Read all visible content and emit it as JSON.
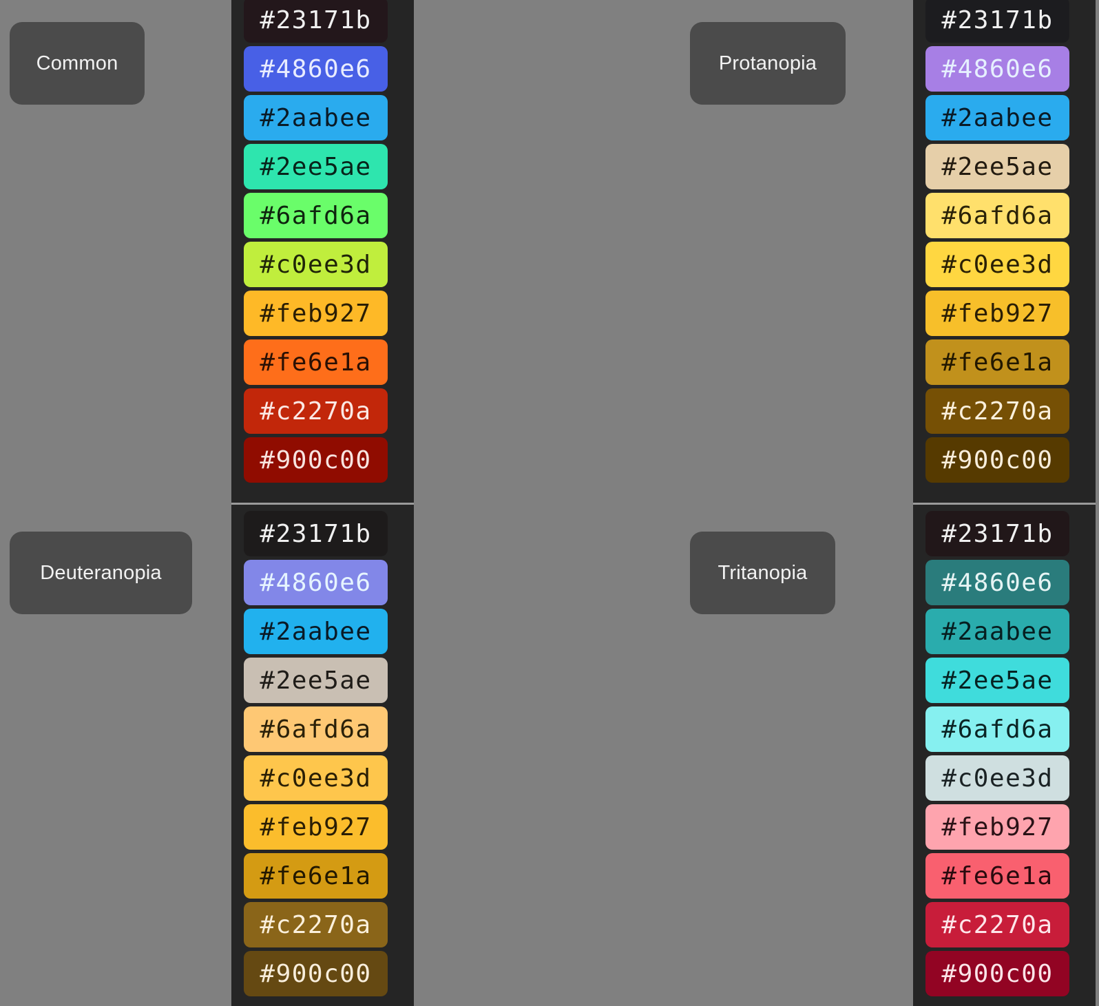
{
  "palettes": [
    {
      "name": "Common",
      "swatches": [
        {
          "label": "#23171b",
          "bg": "#23171b",
          "fg": "#f0f0f0"
        },
        {
          "label": "#4860e6",
          "bg": "#4860e6",
          "fg": "#e8ecff"
        },
        {
          "label": "#2aabee",
          "bg": "#2aabee",
          "fg": "#0a1a26"
        },
        {
          "label": "#2ee5ae",
          "bg": "#2ee5ae",
          "fg": "#08241a"
        },
        {
          "label": "#6afd6a",
          "bg": "#6afd6a",
          "fg": "#0e240e"
        },
        {
          "label": "#c0ee3d",
          "bg": "#c0ee3d",
          "fg": "#1f2408"
        },
        {
          "label": "#feb927",
          "bg": "#feb927",
          "fg": "#2a1e05"
        },
        {
          "label": "#fe6e1a",
          "bg": "#fe6e1a",
          "fg": "#2a1004"
        },
        {
          "label": "#c2270a",
          "bg": "#c2270a",
          "fg": "#fbe8e4"
        },
        {
          "label": "#900c00",
          "bg": "#900c00",
          "fg": "#f8e4e0"
        }
      ]
    },
    {
      "name": "Protanopia",
      "swatches": [
        {
          "label": "#23171b",
          "bg": "#1c1c1f",
          "fg": "#f0f0f0"
        },
        {
          "label": "#4860e6",
          "bg": "#a77fe5",
          "fg": "#e6f0ff"
        },
        {
          "label": "#2aabee",
          "bg": "#2aabee",
          "fg": "#0a1a26"
        },
        {
          "label": "#2ee5ae",
          "bg": "#e6cfa9",
          "fg": "#231b10"
        },
        {
          "label": "#6afd6a",
          "bg": "#ffe06c",
          "fg": "#2a2208"
        },
        {
          "label": "#c0ee3d",
          "bg": "#ffd741",
          "fg": "#2a2005"
        },
        {
          "label": "#feb927",
          "bg": "#f7bf2a",
          "fg": "#2a1e05"
        },
        {
          "label": "#fe6e1a",
          "bg": "#c1911c",
          "fg": "#221800"
        },
        {
          "label": "#c2270a",
          "bg": "#765005",
          "fg": "#fbf0dc"
        },
        {
          "label": "#900c00",
          "bg": "#563a00",
          "fg": "#f8eedc"
        }
      ]
    },
    {
      "name": "Deuteranopia",
      "swatches": [
        {
          "label": "#23171b",
          "bg": "#1d1b1b",
          "fg": "#f0f0f0"
        },
        {
          "label": "#4860e6",
          "bg": "#8287e8",
          "fg": "#e6f4ff"
        },
        {
          "label": "#2aabee",
          "bg": "#21b1ee",
          "fg": "#0a1a26"
        },
        {
          "label": "#2ee5ae",
          "bg": "#c9bfb3",
          "fg": "#1f1c18"
        },
        {
          "label": "#6afd6a",
          "bg": "#fec874",
          "fg": "#2a2008"
        },
        {
          "label": "#c0ee3d",
          "bg": "#fec64c",
          "fg": "#2a1f05"
        },
        {
          "label": "#feb927",
          "bg": "#fbbd2c",
          "fg": "#2a1e05"
        },
        {
          "label": "#fe6e1a",
          "bg": "#d49b13",
          "fg": "#221800"
        },
        {
          "label": "#c2270a",
          "bg": "#8a6519",
          "fg": "#fbf0dc"
        },
        {
          "label": "#900c00",
          "bg": "#654912",
          "fg": "#f8eedc"
        }
      ]
    },
    {
      "name": "Tritanopia",
      "swatches": [
        {
          "label": "#23171b",
          "bg": "#211719",
          "fg": "#f0f0f0"
        },
        {
          "label": "#4860e6",
          "bg": "#2a7c7c",
          "fg": "#e6f4f4"
        },
        {
          "label": "#2aabee",
          "bg": "#2aacad",
          "fg": "#061e20"
        },
        {
          "label": "#2ee5ae",
          "bg": "#3fdcdc",
          "fg": "#062222"
        },
        {
          "label": "#6afd6a",
          "bg": "#86f0f0",
          "fg": "#0a2424"
        },
        {
          "label": "#c0ee3d",
          "bg": "#cfdfe0",
          "fg": "#1a2224"
        },
        {
          "label": "#feb927",
          "bg": "#fea4ae",
          "fg": "#2a1216"
        },
        {
          "label": "#fe6e1a",
          "bg": "#f9606f",
          "fg": "#2a0a0e"
        },
        {
          "label": "#c2270a",
          "bg": "#c81d3a",
          "fg": "#fde6ea"
        },
        {
          "label": "#900c00",
          "bg": "#920423",
          "fg": "#fbe4e8"
        }
      ]
    }
  ]
}
